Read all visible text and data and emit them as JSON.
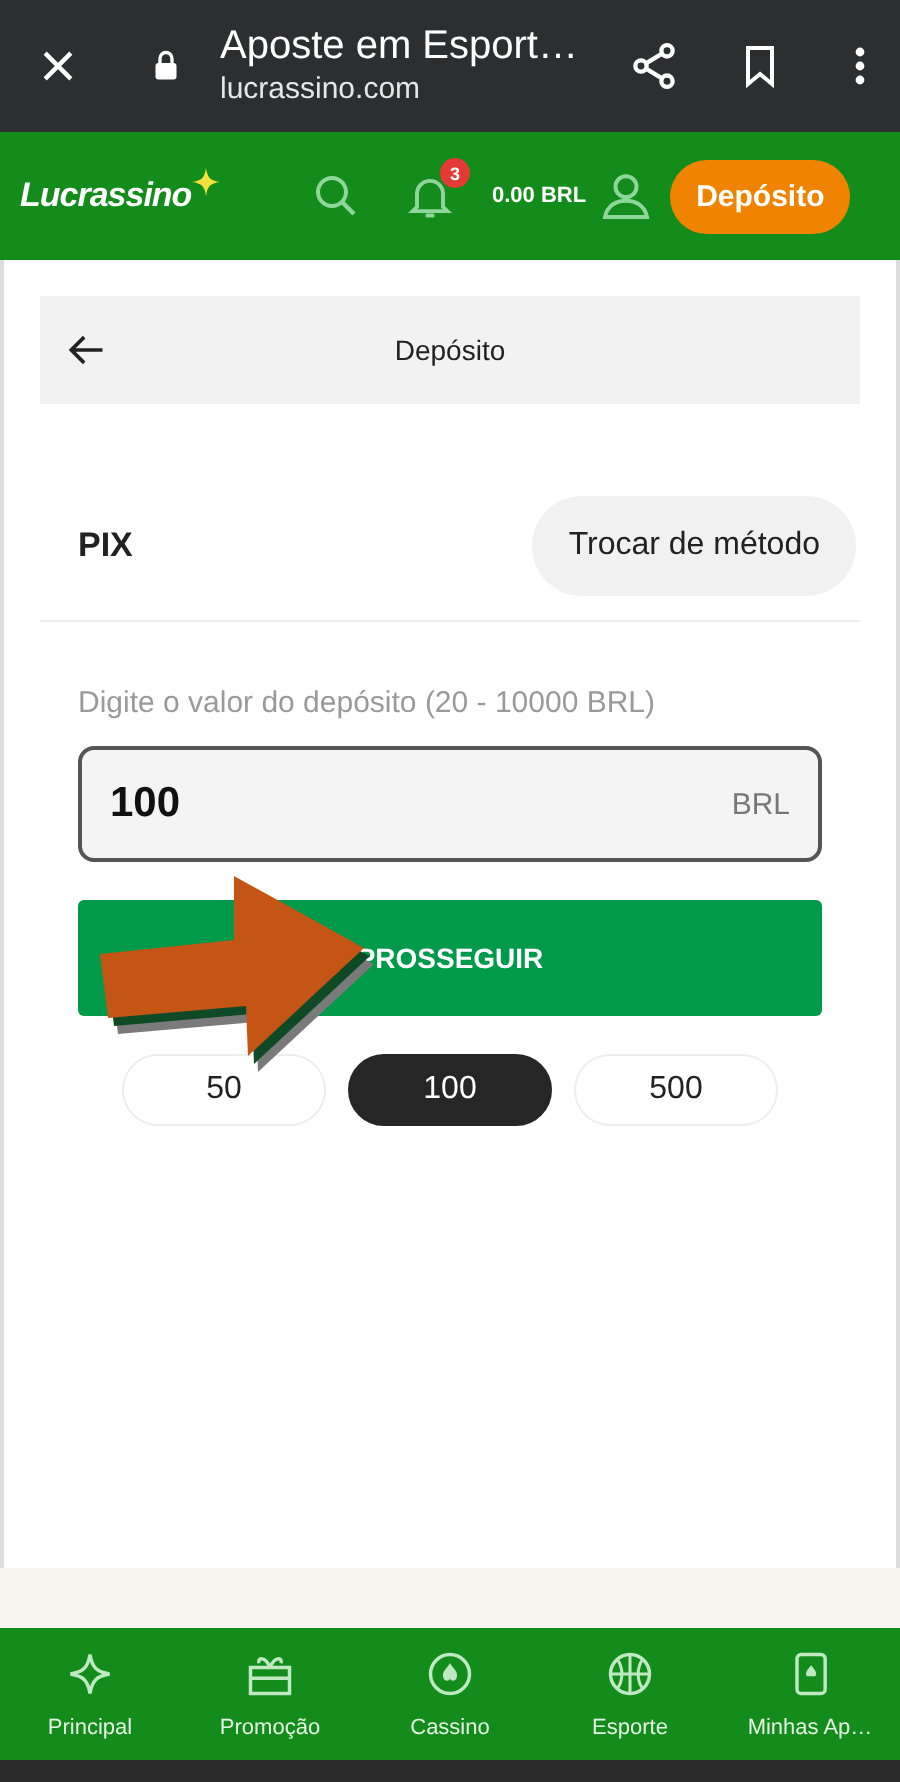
{
  "browser_bar": {
    "title": "Aposte em Esport…",
    "url": "lucrassino.com"
  },
  "header": {
    "logo": "Lucrassino",
    "notification_count": "3",
    "balance": "0.00 BRL",
    "deposit_button": "Depósito"
  },
  "page": {
    "title": "Depósito",
    "method": "PIX",
    "change_method_button": "Trocar de método",
    "amount_label": "Digite o valor do depósito (20 - 10000 BRL)",
    "amount_field": {
      "value": "100",
      "currency": "BRL"
    },
    "submit_button": "PROSSEGUIR",
    "quick_amounts": [
      {
        "label": "50",
        "selected": false
      },
      {
        "label": "100",
        "selected": true
      },
      {
        "label": "500",
        "selected": false
      }
    ]
  },
  "bottom_nav": [
    {
      "label": "Principal"
    },
    {
      "label": "Promoção"
    },
    {
      "label": "Cassino"
    },
    {
      "label": "Esporte"
    },
    {
      "label": "Minhas Ap…"
    }
  ]
}
